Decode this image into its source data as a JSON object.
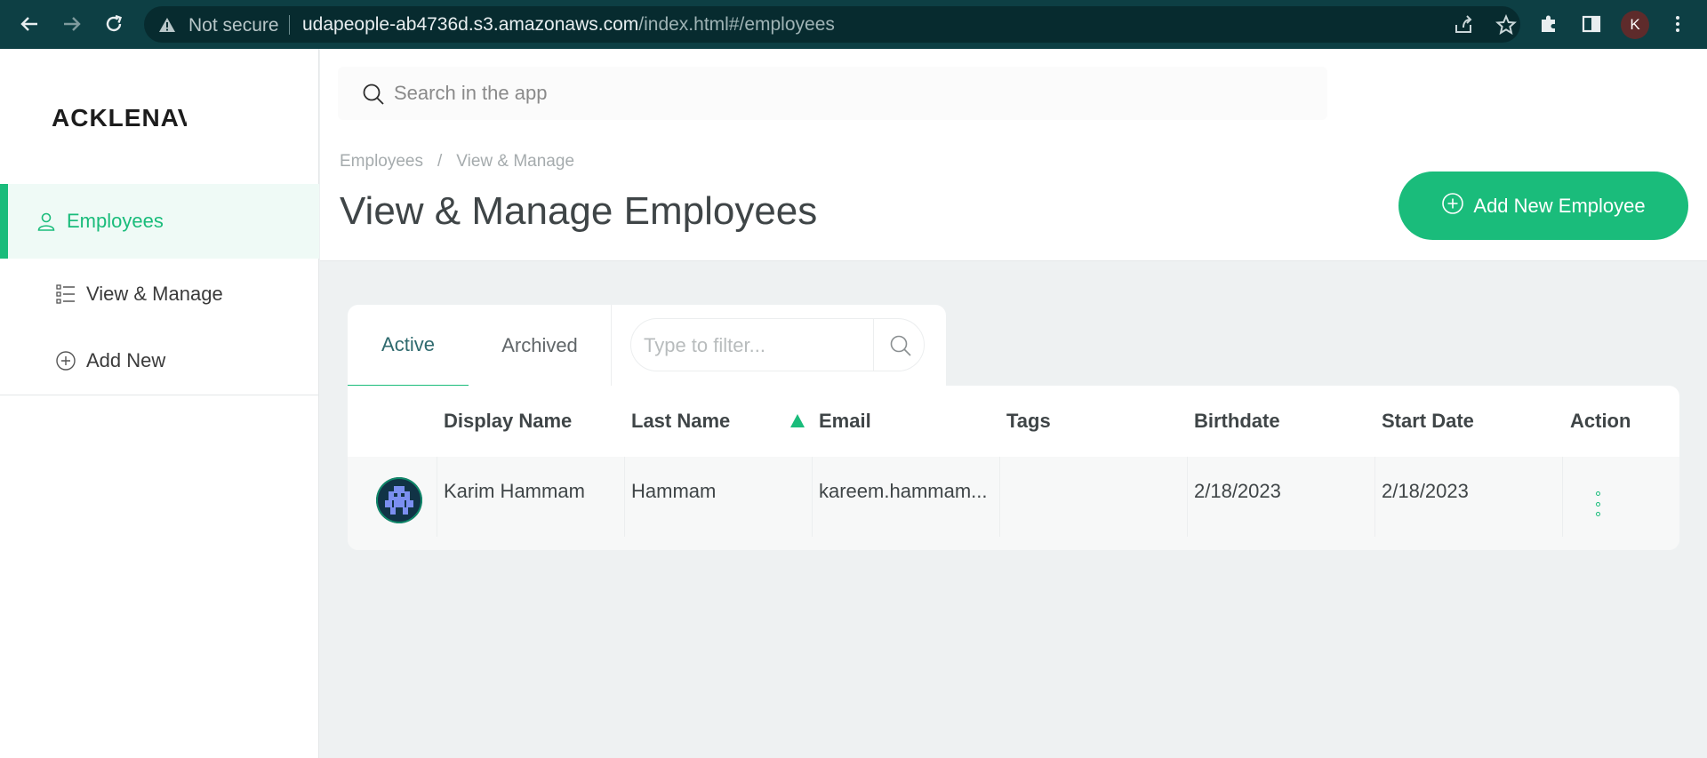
{
  "browser": {
    "security_label": "Not secure",
    "url_host": "udapeople-ab4736d.s3.amazonaws.com",
    "url_path": "/index.html#/employees",
    "profile_initial": "K"
  },
  "sidebar": {
    "logo_text": "ACKLENAVENUE",
    "items": [
      {
        "label": "Employees",
        "icon": "user-icon"
      },
      {
        "label": "View & Manage",
        "icon": "list-icon"
      },
      {
        "label": "Add New",
        "icon": "plus-circle-icon"
      }
    ]
  },
  "search": {
    "placeholder": "Search in the app"
  },
  "header": {
    "breadcrumb": [
      "Employees",
      "View & Manage"
    ],
    "breadcrumb_sep": "/",
    "title": "View & Manage Employees",
    "add_button_label": "Add New Employee"
  },
  "tabs": [
    {
      "label": "Active",
      "active": true
    },
    {
      "label": "Archived",
      "active": false
    }
  ],
  "filter": {
    "placeholder": "Type to filter..."
  },
  "table": {
    "columns": [
      "Display Name",
      "Last Name",
      "Email",
      "Tags",
      "Birthdate",
      "Start Date",
      "Action"
    ],
    "sorted_column": "Email",
    "rows": [
      {
        "display_name": "Karim Hammam",
        "last_name": "Hammam",
        "email": "kareem.hammam...",
        "tags": "",
        "birthdate": "2/18/2023",
        "start_date": "2/18/2023"
      }
    ]
  },
  "colors": {
    "accent": "#1abc7b",
    "chrome_bar": "#0d3f44",
    "content_bg": "#eef1f2"
  }
}
